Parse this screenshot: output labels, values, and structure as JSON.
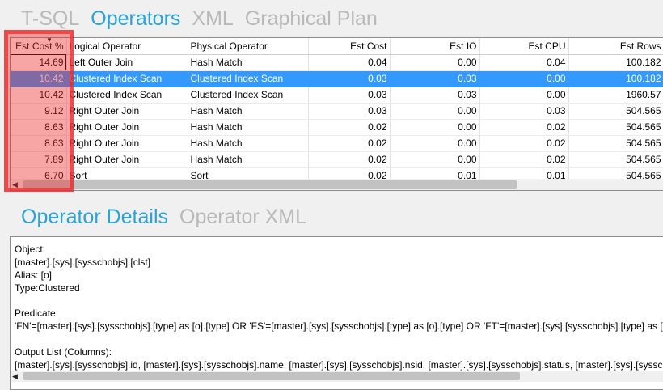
{
  "top_tabs": [
    "T-SQL",
    "Operators",
    "XML",
    "Graphical Plan"
  ],
  "bottom_tabs": [
    "Operator Details",
    "Operator XML"
  ],
  "grid": {
    "columns": [
      "Est Cost %",
      "Logical Operator",
      "Physical Operator",
      "Est Cost",
      "Est IO",
      "Est CPU",
      "Est Rows"
    ],
    "sorted_column": "Est Cost %",
    "selected_row": 1,
    "rows": [
      [
        "14.69",
        "Left Outer Join",
        "Hash Match",
        "0.04",
        "0.00",
        "0.04",
        "100.182"
      ],
      [
        "10.42",
        "Clustered Index Scan",
        "Clustered Index Scan",
        "0.03",
        "0.03",
        "0.00",
        "100.182"
      ],
      [
        "10.42",
        "Clustered Index Scan",
        "Clustered Index Scan",
        "0.03",
        "0.03",
        "0.00",
        "1960.57"
      ],
      [
        "9.12",
        "Right Outer Join",
        "Hash Match",
        "0.03",
        "0.00",
        "0.03",
        "504.565"
      ],
      [
        "8.63",
        "Right Outer Join",
        "Hash Match",
        "0.02",
        "0.00",
        "0.02",
        "504.565"
      ],
      [
        "8.63",
        "Right Outer Join",
        "Hash Match",
        "0.02",
        "0.00",
        "0.02",
        "504.565"
      ],
      [
        "7.89",
        "Right Outer Join",
        "Hash Match",
        "0.02",
        "0.00",
        "0.02",
        "504.565"
      ],
      [
        "6.70",
        "Sort",
        "Sort",
        "0.02",
        "0.01",
        "0.01",
        "504.565"
      ]
    ]
  },
  "details": {
    "lines": [
      "Object:",
      "[master].[sys].[sysschobjs].[clst]",
      "Alias: [o]",
      "Type:Clustered",
      "",
      "Predicate:",
      "'FN'=[master].[sys].[sysschobjs].[type] as [o].[type] OR 'FS'=[master].[sys].[sysschobjs].[type] as [o].[type] OR 'FT'=[master].[sys].[sysschobjs].[type] as [o].[t",
      "",
      "Output List (Columns):",
      "[master].[sys].[sysschobjs].id, [master].[sys].[sysschobjs].name, [master].[sys].[sysschobjs].nsid, [master].[sys].[sysschobjs].status, [master].[sys].[sysschobjs]."
    ]
  },
  "colors": {
    "accent": "#2aa3d9",
    "inactive_tab": "#b9b9b9",
    "selection": "#3399ff",
    "highlight": "#eb2828"
  },
  "icons": {
    "sort": "sort-descending-icon",
    "scroll_left": "scroll-left-arrow-icon"
  }
}
